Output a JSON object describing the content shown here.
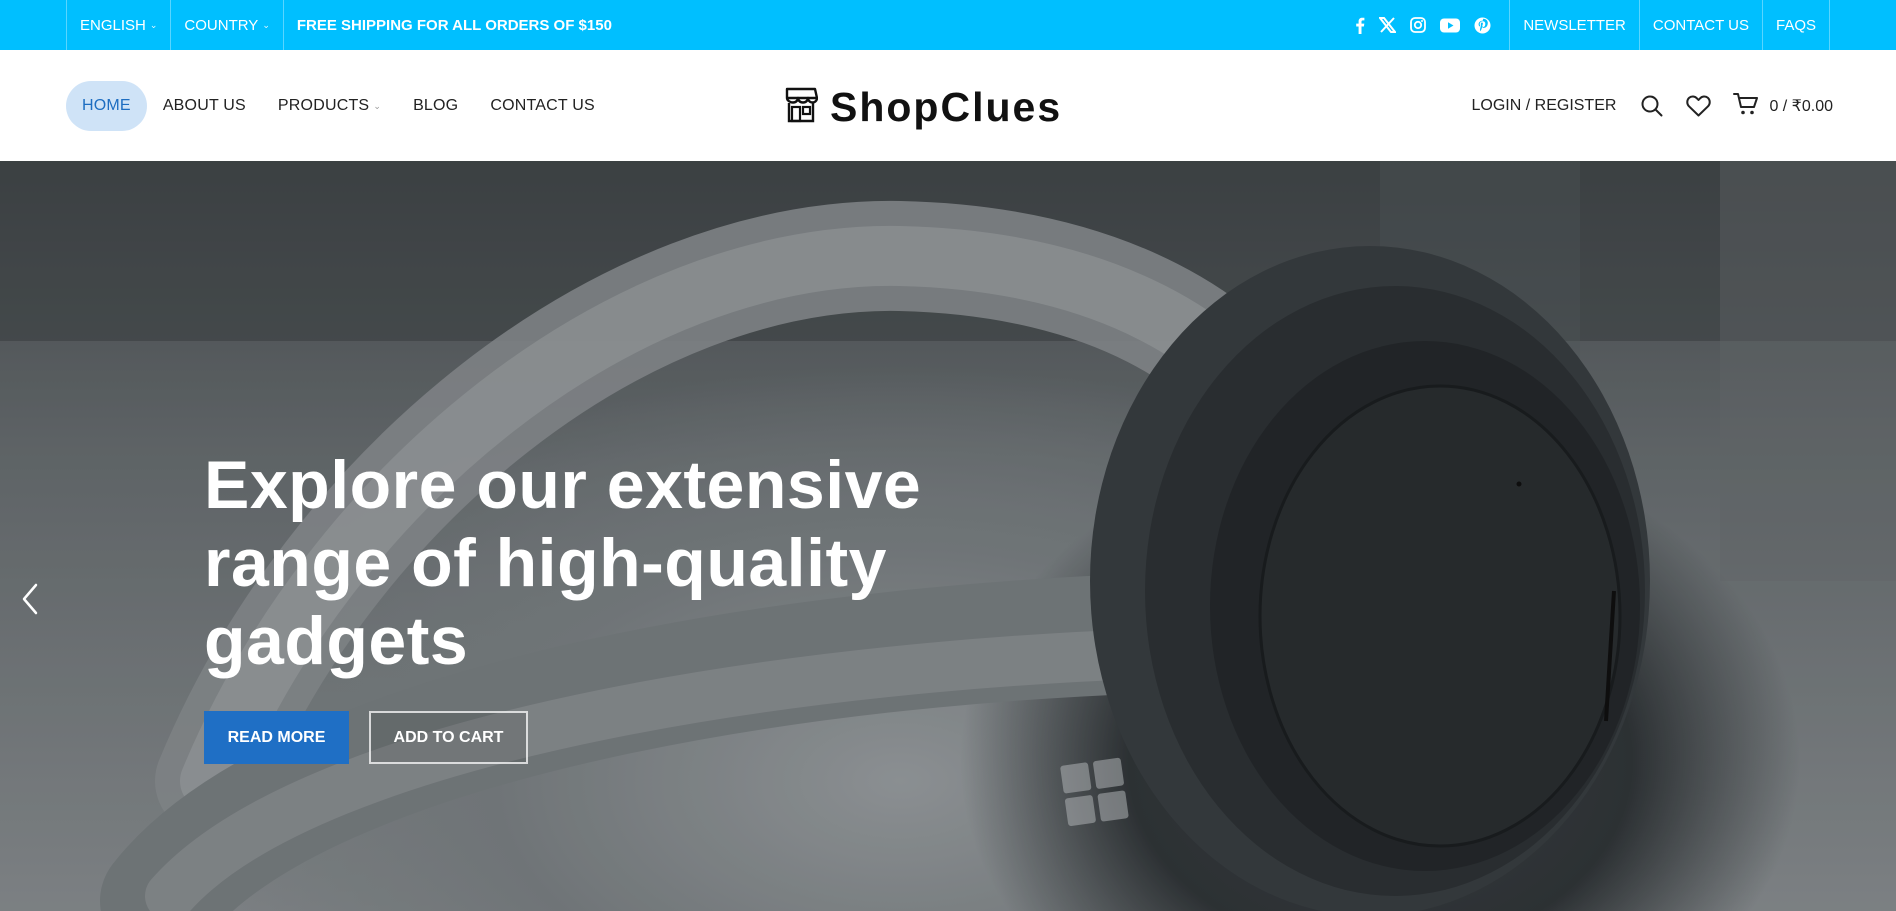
{
  "topbar": {
    "language": "ENGLISH",
    "country": "COUNTRY",
    "promo": "FREE SHIPPING FOR ALL ORDERS OF $150",
    "social_icons": [
      "facebook-icon",
      "x-twitter-icon",
      "instagram-icon",
      "youtube-icon",
      "pinterest-icon"
    ],
    "links": [
      "NEWSLETTER",
      "CONTACT US",
      "FAQS"
    ],
    "background": "#00bfff"
  },
  "nav": {
    "items": [
      "HOME",
      "ABOUT US",
      "PRODUCTS",
      "BLOG",
      "CONTACT US"
    ],
    "active": "HOME",
    "active_color": "#1d6dc1"
  },
  "logo": {
    "text": "ShopClues",
    "icon": "storefront-icon"
  },
  "header_right": {
    "login": "LOGIN / REGISTER",
    "cart_amount": "0 / ₹0.00",
    "icons": [
      "search-icon",
      "heart-icon",
      "cart-icon"
    ]
  },
  "hero": {
    "title_lines": [
      "Explore our extensive",
      "range of high-quality",
      "gadgets"
    ],
    "primary_button": "READ MORE",
    "secondary_button": "ADD TO CART",
    "primary_color": "#1f6fc5"
  }
}
